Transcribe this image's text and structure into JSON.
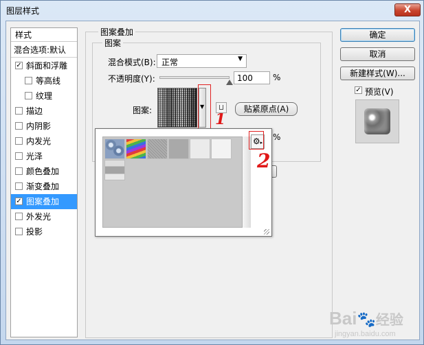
{
  "window": {
    "title": "图层样式",
    "close_glyph": "X"
  },
  "sidebar": {
    "header": "样式",
    "blend_item": "混合选项:默认",
    "items": [
      {
        "label": "斜面和浮雕",
        "checked": true,
        "glyph": "✓",
        "indent": false
      },
      {
        "label": "等高线",
        "checked": false,
        "glyph": "",
        "indent": true
      },
      {
        "label": "纹理",
        "checked": false,
        "glyph": "",
        "indent": true
      },
      {
        "label": "描边",
        "checked": false,
        "glyph": "",
        "indent": false
      },
      {
        "label": "内阴影",
        "checked": false,
        "glyph": "",
        "indent": false
      },
      {
        "label": "内发光",
        "checked": false,
        "glyph": "",
        "indent": false
      },
      {
        "label": "光泽",
        "checked": false,
        "glyph": "",
        "indent": false
      },
      {
        "label": "颜色叠加",
        "checked": false,
        "glyph": "",
        "indent": false
      },
      {
        "label": "渐变叠加",
        "checked": false,
        "glyph": "",
        "indent": false
      },
      {
        "label": "图案叠加",
        "checked": true,
        "glyph": "✓",
        "indent": false,
        "selected": true
      },
      {
        "label": "外发光",
        "checked": false,
        "glyph": "",
        "indent": false
      },
      {
        "label": "投影",
        "checked": false,
        "glyph": "",
        "indent": false
      }
    ]
  },
  "panel": {
    "outer_group": "图案叠加",
    "inner_group": "图案",
    "blend_mode_label": "混合模式(B):",
    "blend_mode_value": "正常",
    "opacity_label": "不透明度(Y):",
    "opacity_value": "100",
    "opacity_unit": "%",
    "opacity_level": 1.0,
    "pattern_label": "图案:",
    "snap_button": "贴紧原点(A)",
    "hidden_percent": "%"
  },
  "pattern_picker": {
    "gear_glyph": "⚙",
    "swatches": [
      "blue-bubbles",
      "rainbow-stripes",
      "gray-noise",
      "gray-solid",
      "white-texture",
      "white-light",
      "gray-gradient"
    ]
  },
  "buttons": {
    "ok": "确定",
    "cancel": "取消",
    "new_style": "新建样式(W)...",
    "preview": "预览(V)",
    "preview_checked": true,
    "preview_glyph": "✓"
  },
  "annotations": {
    "one": "1",
    "two": "2"
  },
  "watermark": {
    "text": "Bai",
    "paw": "🐾",
    "tail": "经验",
    "url": "jingyan.baidu.com"
  },
  "colors": {
    "selection": "#3399ff",
    "annotation": "#e01818",
    "window_frame": "#c4d7ee"
  }
}
